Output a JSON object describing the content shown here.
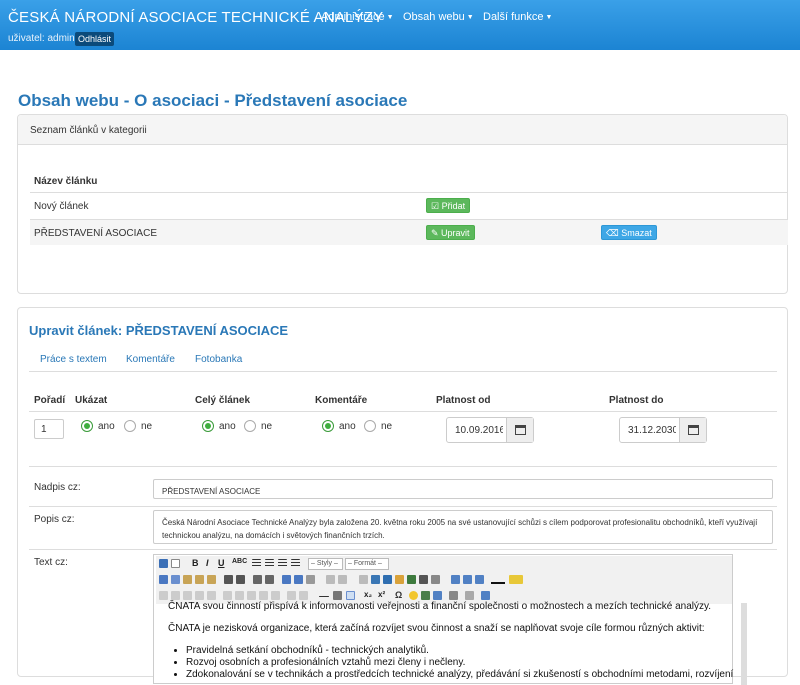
{
  "navbar": {
    "brand": "ČESKÁ NÁRODNÍ ASOCIACE TECHNICKÉ ANALÝZY",
    "menus": [
      "Administrace",
      "Obsah webu",
      "Další funkce"
    ],
    "user_label": "uživatel: admin",
    "logout_label": "Odhlásit"
  },
  "page_title": "Obsah webu - O asociaci - Představení asociace",
  "articles_panel": {
    "heading": "Seznam článků v kategorii",
    "column_header": "Název článku",
    "rows": [
      {
        "name": "Nový článek",
        "action1": "Přidat"
      },
      {
        "name": "PŘEDSTAVENÍ ASOCIACE",
        "action1": "Upravit",
        "action2": "Smazat"
      }
    ]
  },
  "edit_panel": {
    "title": "Upravit článek: PŘEDSTAVENÍ ASOCIACE",
    "tabs": [
      "Práce s textem",
      "Komentáře",
      "Fotobanka"
    ],
    "labels": {
      "order": "Pořadí",
      "show": "Ukázat",
      "full": "Celý článek",
      "comments": "Komentáře",
      "valid_from": "Platnost od",
      "valid_to": "Platnost do"
    },
    "order_value": "1",
    "yes": "ano",
    "no": "ne",
    "valid_from": "10.09.2016",
    "valid_to": "31.12.2030",
    "heading_label": "Nadpis cz:",
    "heading_value": "PŘEDSTAVENÍ ASOCIACE",
    "desc_label": "Popis cz:",
    "desc_value": "Česká Národní Asociace Technické Analýzy byla založena 20. května roku 2005 na své ustanovující schůzi s cílem podporovat profesionalitu obchodníků, kteří využívají technickou analýzu, na domácích i světových finančních trzích.",
    "text_label": "Text cz:",
    "toolbar": {
      "styles": "– Styly –",
      "format": "– Formát –"
    },
    "content": {
      "p1": "ČNATA svou činností přispívá k informovanosti veřejnosti a finanční společnosti o možnostech a mezích technické analýzy.",
      "p2": "ČNATA je nezisková organizace, která začíná rozvíjet svou činnost a snaží se naplňovat svoje cíle formou různých aktivit:",
      "list": [
        "Pravidelná setkání obchodníků - technických analytiků.",
        "Rozvoj osobních a profesionálních vztahů mezi členy i nečleny.",
        "Zdokonalování se v technikách a prostředcích technické analýzy, předávání si zkušeností s obchodními metodami, rozvíjení"
      ]
    }
  },
  "colors": {
    "navbar": "#1c84d3",
    "accent": "#2a78b7",
    "green": "#5cb85c",
    "blue": "#3ea7e6"
  }
}
